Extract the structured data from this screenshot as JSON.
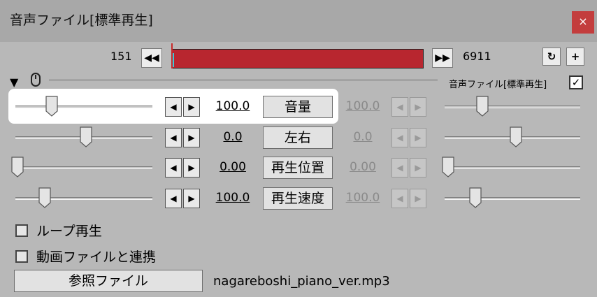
{
  "window": {
    "title": "音声ファイル[標準再生]",
    "close_icon": "close-icon"
  },
  "timeline": {
    "start_frame": "151",
    "end_frame": "6911",
    "prev_icon": "◀◀",
    "next_icon": "▶▶",
    "sync_icon": "↻",
    "add_icon": "+",
    "bar_color": "#b8262f"
  },
  "header": {
    "collapse_icon": "▼",
    "object_label": "音声ファイル[標準再生]",
    "object_checked": "✓"
  },
  "tracks": [
    {
      "name": "音量",
      "value_left": "100.0",
      "value_right": "100.0",
      "slider_left": 0.25,
      "slider_right": 0.25
    },
    {
      "name": "左右",
      "value_left": "0.0",
      "value_right": "0.0",
      "slider_left": 0.5,
      "slider_right": 0.5
    },
    {
      "name": "再生位置",
      "value_left": "0.00",
      "value_right": "0.00",
      "slider_left": 0.0,
      "slider_right": 0.0
    },
    {
      "name": "再生速度",
      "value_left": "100.0",
      "value_right": "100.0",
      "slider_left": 0.2,
      "slider_right": 0.2
    }
  ],
  "arrows": {
    "left": "◀",
    "right": "▶"
  },
  "checkboxes": [
    {
      "label": "ループ再生",
      "checked": false
    },
    {
      "label": "動画ファイルと連携",
      "checked": false
    }
  ],
  "reference": {
    "button_label": "参照ファイル",
    "filename": "nagareboshi_piano_ver.mp3"
  }
}
